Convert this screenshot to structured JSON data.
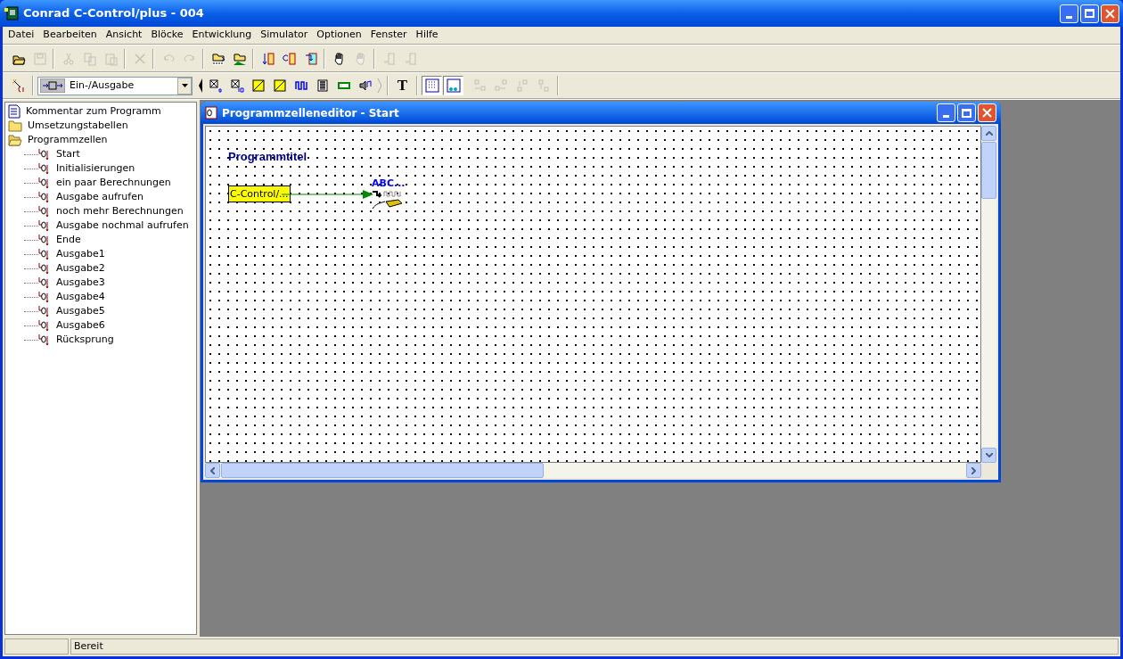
{
  "window": {
    "title": "Conrad C-Control/plus - 004"
  },
  "menu": [
    "Datei",
    "Bearbeiten",
    "Ansicht",
    "Blöcke",
    "Entwicklung",
    "Simulator",
    "Optionen",
    "Fenster",
    "Hilfe"
  ],
  "toolbar_1": [
    [
      {
        "kind": "open",
        "disabled": false
      },
      {
        "kind": "save",
        "disabled": true
      }
    ],
    [
      {
        "kind": "cut",
        "disabled": true
      },
      {
        "kind": "copy",
        "disabled": true
      },
      {
        "kind": "paste",
        "disabled": true
      }
    ],
    [
      {
        "kind": "delete",
        "disabled": true
      }
    ],
    [
      {
        "kind": "undo",
        "disabled": true
      },
      {
        "kind": "redo",
        "disabled": true
      }
    ],
    [
      {
        "kind": "compile",
        "disabled": false
      },
      {
        "kind": "upload",
        "disabled": false
      }
    ],
    [
      {
        "kind": "step-down",
        "disabled": false
      },
      {
        "kind": "step-loop",
        "disabled": false
      },
      {
        "kind": "step-into",
        "disabled": false
      }
    ],
    [
      {
        "kind": "hand",
        "disabled": false
      },
      {
        "kind": "hand",
        "disabled": true
      }
    ],
    [
      {
        "kind": "link",
        "disabled": true
      },
      {
        "kind": "link",
        "disabled": true
      }
    ]
  ],
  "toolbar_2": {
    "wand": {
      "disabled": false
    },
    "category": {
      "value": "Ein-/Ausgabe"
    },
    "blocks": [
      {
        "kind": "digital8",
        "disabled": false
      },
      {
        "kind": "digital16",
        "disabled": false
      },
      {
        "kind": "ad",
        "disabled": false
      },
      {
        "kind": "da",
        "disabled": false
      },
      {
        "kind": "wave",
        "disabled": false
      },
      {
        "kind": "grid",
        "disabled": false
      },
      {
        "kind": "display",
        "disabled": false
      },
      {
        "kind": "sound",
        "disabled": false
      }
    ],
    "text_tool": {
      "label": "T"
    },
    "view": [
      {
        "kind": "dots",
        "selected": true
      },
      {
        "kind": "overview",
        "selected": true
      }
    ],
    "align": [
      {
        "kind": "left",
        "disabled": true
      },
      {
        "kind": "right",
        "disabled": true
      },
      {
        "kind": "up",
        "disabled": true
      },
      {
        "kind": "down",
        "disabled": true
      }
    ]
  },
  "tree": [
    {
      "label": "Kommentar zum Programm",
      "kind": "document"
    },
    {
      "label": "Umsetzungstabellen",
      "kind": "folder"
    },
    {
      "label": "Programmzellen",
      "kind": "folder-open",
      "children": [
        {
          "label": "Start",
          "kind": "cell"
        },
        {
          "label": "Initialisierungen",
          "kind": "cell"
        },
        {
          "label": "ein paar Berechnungen",
          "kind": "cell"
        },
        {
          "label": "Ausgabe aufrufen",
          "kind": "cell"
        },
        {
          "label": "noch mehr Berechnungen",
          "kind": "cell"
        },
        {
          "label": "Ausgabe nochmal aufrufen",
          "kind": "cell"
        },
        {
          "label": "Ende",
          "kind": "cell"
        },
        {
          "label": "Ausgabe1",
          "kind": "cell"
        },
        {
          "label": "Ausgabe2",
          "kind": "cell"
        },
        {
          "label": "Ausgabe3",
          "kind": "cell"
        },
        {
          "label": "Ausgabe4",
          "kind": "cell"
        },
        {
          "label": "Ausgabe5",
          "kind": "cell"
        },
        {
          "label": "Ausgabe6",
          "kind": "cell"
        },
        {
          "label": "Rücksprung",
          "kind": "cell"
        }
      ]
    }
  ],
  "editor": {
    "title": "Programmzelleneditor - Start",
    "canvas_title": "Programmtitel",
    "source_block": "C-Control/...",
    "output_block": "ABC..."
  },
  "status_bar": {
    "text": "Bereit"
  }
}
